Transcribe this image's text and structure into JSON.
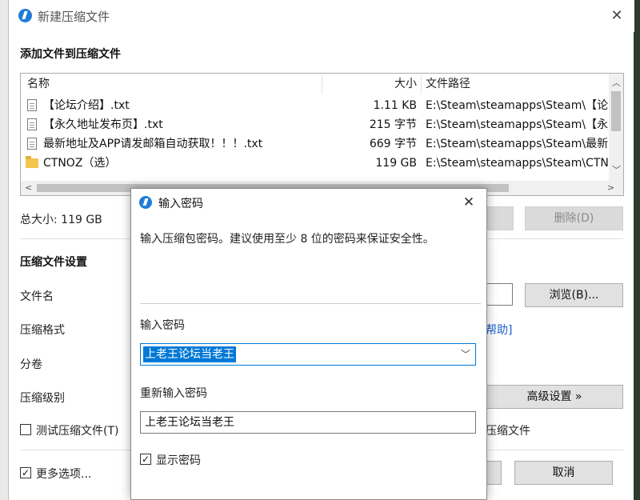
{
  "window": {
    "title": "新建压缩文件",
    "close_glyph": "✕"
  },
  "add_files": {
    "section_title": "添加文件到压缩文件",
    "columns": {
      "name": "名称",
      "size": "大小",
      "path": "文件路径"
    },
    "rows": [
      {
        "icon": "file-icon",
        "name": "【论坛介绍】.txt",
        "size": "1.11 KB",
        "path": "E:\\Steam\\steamapps\\Steam\\【论"
      },
      {
        "icon": "file-icon",
        "name": "【永久地址发布页】.txt",
        "size": "215 字节",
        "path": "E:\\Steam\\steamapps\\Steam\\【永"
      },
      {
        "icon": "file-icon",
        "name": "最新地址及APP请发邮箱自动获取！！！.txt",
        "size": "669 字节",
        "path": "E:\\Steam\\steamapps\\Steam\\最新"
      },
      {
        "icon": "folder-icon",
        "name": "CTNOZ（选）",
        "size": "119 GB",
        "path": "E:\\Steam\\steamapps\\Steam\\CTN"
      }
    ],
    "total_size": "总大小: 119 GB",
    "delete_button": "删除(D)"
  },
  "settings": {
    "section_title": "压缩文件设置",
    "filename_label": "文件名",
    "format_label": "压缩格式",
    "help_link": "帮助]",
    "split_label": "分卷",
    "level_label": "压缩级别",
    "browse_button": "浏览(B)...",
    "advanced_button": "高级设置 »",
    "test_checkbox": {
      "label": "测试压缩文件(T)",
      "checked": false
    },
    "right_checkbox_label": "压缩文件",
    "more_options": {
      "label": "更多选项...",
      "checked": true
    },
    "cancel_button": "取消"
  },
  "dialog": {
    "title": "输入密码",
    "close_glyph": "✕",
    "hint": "输入压缩包密码。建议使用至少 8 位的密码来保证安全性。",
    "password_label": "输入密码",
    "password_value": "上老王论坛当老王",
    "confirm_label": "重新输入密码",
    "confirm_value": "上老王论坛当老王",
    "show_password": {
      "label": "显示密码",
      "checked": true
    }
  }
}
